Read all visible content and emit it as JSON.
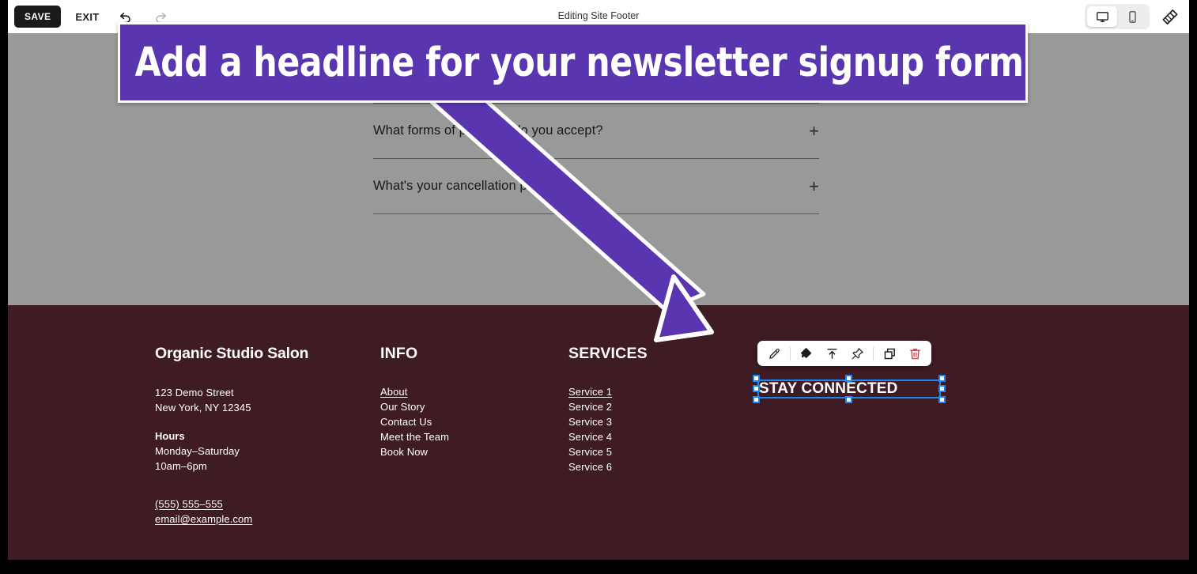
{
  "editor": {
    "title": "Editing Site Footer",
    "save_label": "SAVE",
    "exit_label": "EXIT",
    "undo_icon": "undo-arrow-icon",
    "redo_icon": "redo-arrow-icon",
    "device_desktop_icon": "desktop-monitor-icon",
    "device_mobile_icon": "mobile-phone-icon",
    "design_icon": "paintbrush-icon",
    "accent_purple": "#5A35B0",
    "selection_blue": "#1A85F5"
  },
  "callout": {
    "text": "Add a headline for your newsletter signup form",
    "background": "#5A35B0",
    "border": "#FFFFFF",
    "arrow_icon": "annotation-arrow-icon"
  },
  "element_toolbar": {
    "buttons": [
      {
        "name": "edit-button",
        "icon": "pencil-icon"
      },
      {
        "name": "style-button",
        "icon": "paint-bucket-icon"
      },
      {
        "name": "move-to-top-button",
        "icon": "arrow-up-to-line-icon"
      },
      {
        "name": "pin-button",
        "icon": "pin-icon"
      },
      {
        "name": "duplicate-button",
        "icon": "duplicate-icon"
      },
      {
        "name": "delete-button",
        "icon": "trash-icon",
        "color": "#E8363D"
      }
    ]
  },
  "faq": {
    "items": [
      {
        "question": "What forms of payment do you accept?",
        "expander": "+"
      },
      {
        "question": "What's your cancellation policy?",
        "expander": "+"
      }
    ]
  },
  "footer": {
    "background": "#3F1C24",
    "brand": {
      "title": "Organic Studio Salon",
      "address_line1": "123 Demo Street",
      "address_line2": "New York, NY 12345",
      "hours_label": "Hours",
      "hours_line1": "Monday–Saturday",
      "hours_line2": "10am–6pm",
      "phone": "(555) 555–555",
      "email": "email@example.com"
    },
    "info": {
      "heading": "INFO",
      "links": [
        "About",
        "Our Story",
        "Contact Us",
        "Meet the Team",
        "Book Now"
      ]
    },
    "services": {
      "heading": "SERVICES",
      "links": [
        "Service 1",
        "Service 2",
        "Service 3",
        "Service 4",
        "Service 5",
        "Service 6"
      ]
    },
    "newsletter": {
      "heading": "STAY CONNECTED"
    }
  }
}
